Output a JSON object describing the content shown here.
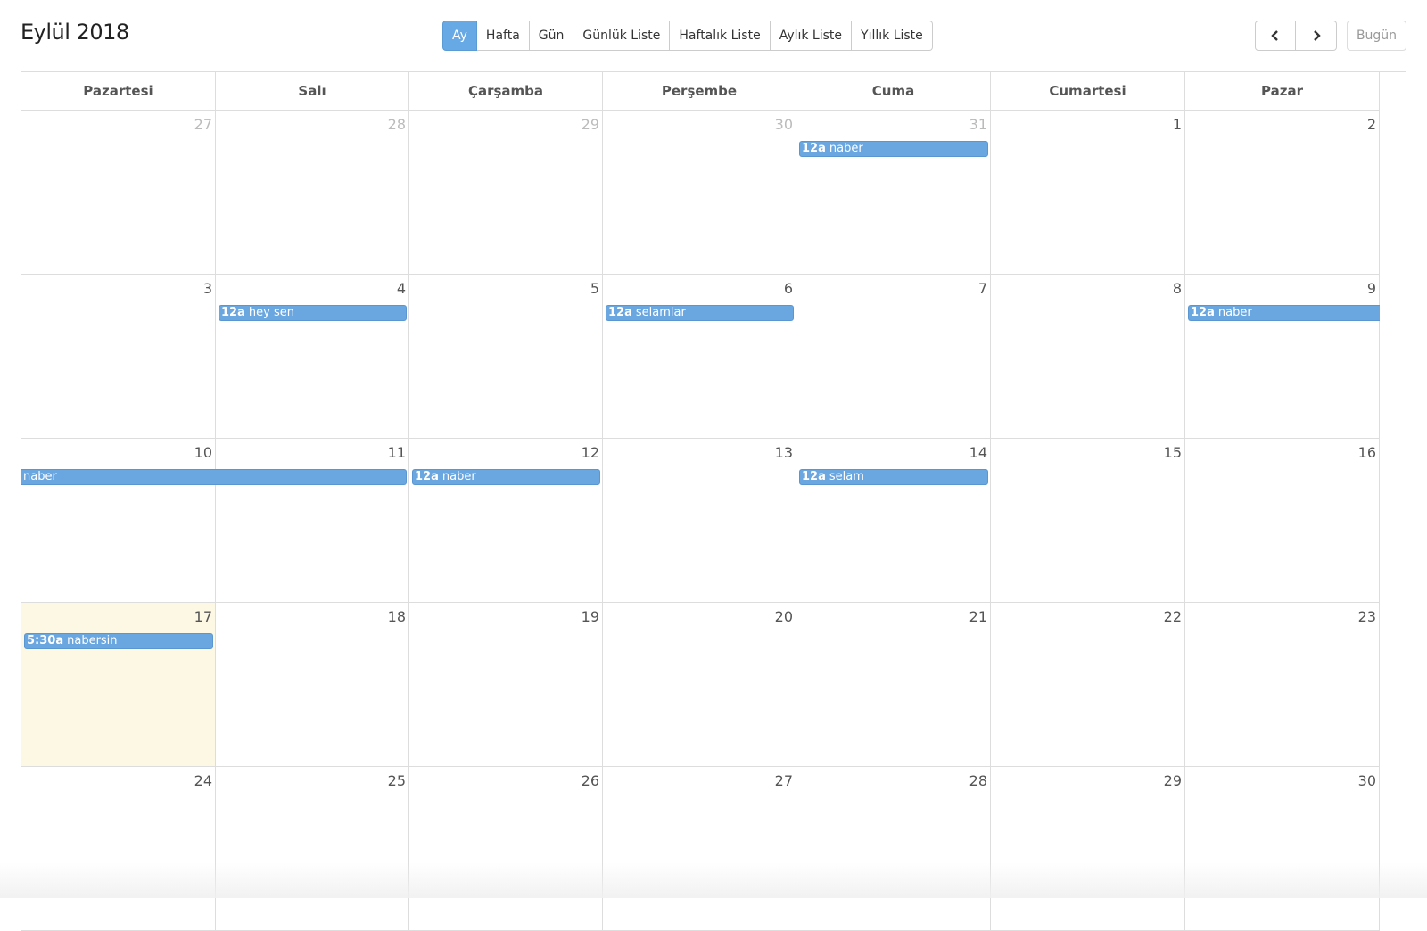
{
  "header": {
    "title": "Eylül 2018",
    "views": [
      "Ay",
      "Hafta",
      "Gün",
      "Günlük Liste",
      "Haftalık Liste",
      "Aylık Liste",
      "Yıllık Liste"
    ],
    "active_view": "Ay",
    "prev_icon": "chevron-left-icon",
    "next_icon": "chevron-right-icon",
    "today_label": "Bugün"
  },
  "weekdays": [
    "Pazartesi",
    "Salı",
    "Çarşamba",
    "Perşembe",
    "Cuma",
    "Cumartesi",
    "Pazar"
  ],
  "weeks": [
    {
      "days": [
        {
          "num": "27",
          "other": true
        },
        {
          "num": "28",
          "other": true
        },
        {
          "num": "29",
          "other": true
        },
        {
          "num": "30",
          "other": true
        },
        {
          "num": "31",
          "other": true
        },
        {
          "num": "1"
        },
        {
          "num": "2"
        }
      ]
    },
    {
      "days": [
        {
          "num": "3"
        },
        {
          "num": "4"
        },
        {
          "num": "5"
        },
        {
          "num": "6"
        },
        {
          "num": "7"
        },
        {
          "num": "8"
        },
        {
          "num": "9"
        }
      ]
    },
    {
      "days": [
        {
          "num": "10"
        },
        {
          "num": "11"
        },
        {
          "num": "12"
        },
        {
          "num": "13"
        },
        {
          "num": "14"
        },
        {
          "num": "15"
        },
        {
          "num": "16"
        }
      ]
    },
    {
      "days": [
        {
          "num": "17",
          "today": true
        },
        {
          "num": "18"
        },
        {
          "num": "19"
        },
        {
          "num": "20"
        },
        {
          "num": "21"
        },
        {
          "num": "22"
        },
        {
          "num": "23"
        }
      ]
    },
    {
      "days": [
        {
          "num": "24"
        },
        {
          "num": "25"
        },
        {
          "num": "26"
        },
        {
          "num": "27"
        },
        {
          "num": "28"
        },
        {
          "num": "29"
        },
        {
          "num": "30"
        }
      ]
    }
  ],
  "events": [
    {
      "week": 0,
      "start": 4,
      "span": 1,
      "time": "12a",
      "title": "naber"
    },
    {
      "week": 1,
      "start": 1,
      "span": 1,
      "time": "12a",
      "title": "hey sen"
    },
    {
      "week": 1,
      "start": 3,
      "span": 1,
      "time": "12a",
      "title": "selamlar"
    },
    {
      "week": 1,
      "start": 6,
      "span": 1,
      "time": "12a",
      "title": "naber",
      "open_end": true
    },
    {
      "week": 2,
      "start": 0,
      "span": 2,
      "time": "",
      "title": "naber",
      "continued": true
    },
    {
      "week": 2,
      "start": 2,
      "span": 1,
      "time": "12a",
      "title": "naber"
    },
    {
      "week": 2,
      "start": 4,
      "span": 1,
      "time": "12a",
      "title": "selam"
    },
    {
      "week": 3,
      "start": 0,
      "span": 1,
      "time": "5:30a",
      "title": "nabersin"
    }
  ],
  "colors": {
    "accent": "#67a9e4",
    "event": "#6aa6e0",
    "today_bg": "#fcf8e3"
  }
}
